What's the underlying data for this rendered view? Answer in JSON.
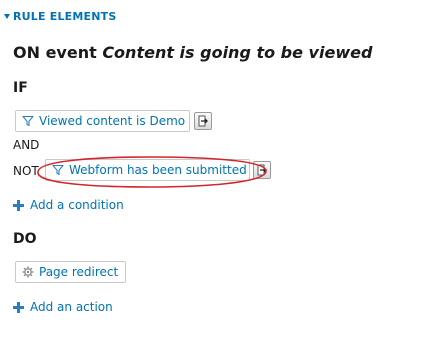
{
  "section": {
    "label": "RULE ELEMENTS"
  },
  "event": {
    "prefix": "ON event",
    "name": "Content is going to be viewed"
  },
  "if_section": {
    "heading": "IF",
    "conditions": [
      {
        "label": "Viewed content is Demo",
        "icon": "filter-icon",
        "negated": false
      },
      {
        "label": "Webform has been submitted",
        "icon": "filter-icon",
        "negated": true
      }
    ],
    "and_label": "AND",
    "not_label": "NOT",
    "add_label": "Add a condition"
  },
  "do_section": {
    "heading": "DO",
    "actions": [
      {
        "label": "Page redirect",
        "icon": "gear-icon"
      }
    ],
    "add_label": "Add an action"
  },
  "colors": {
    "link": "#0073b6",
    "annotation": "#d6242a"
  }
}
